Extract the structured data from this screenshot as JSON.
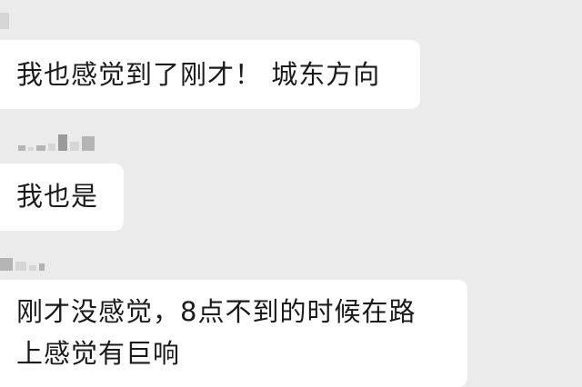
{
  "messages": [
    {
      "lines": [
        "我也感觉到了刚才！ 城东方向"
      ]
    },
    {
      "lines": [
        "我也是"
      ]
    },
    {
      "lines": [
        "刚才没感觉，8点不到的时候在路",
        "上感觉有巨响"
      ]
    }
  ]
}
